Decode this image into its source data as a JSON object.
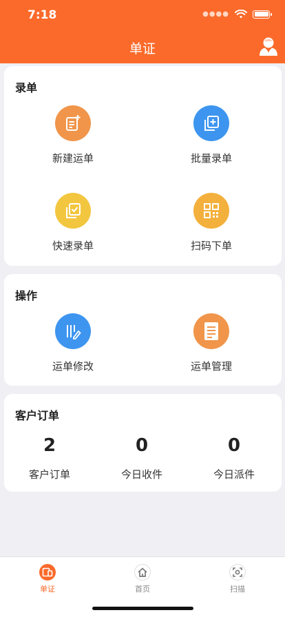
{
  "status": {
    "time": "7:18"
  },
  "nav": {
    "title": "单证",
    "user_icon": "user-avatar-icon"
  },
  "sections": {
    "entry": {
      "title": "录单",
      "items": [
        {
          "label": "新建运单",
          "icon": "new-waybill-icon",
          "color": "#f0954a"
        },
        {
          "label": "批量录单",
          "icon": "batch-entry-icon",
          "color": "#3d95f0"
        },
        {
          "label": "快速录单",
          "icon": "quick-entry-icon",
          "color": "#f3c640"
        },
        {
          "label": "扫码下单",
          "icon": "qr-code-icon",
          "color": "#f3b03c"
        }
      ]
    },
    "operation": {
      "title": "操作",
      "items": [
        {
          "label": "运单修改",
          "icon": "edit-waybill-icon",
          "color": "#3d95f0"
        },
        {
          "label": "运单管理",
          "icon": "manage-waybill-icon",
          "color": "#f0954a"
        }
      ]
    },
    "orders": {
      "title": "客户订单",
      "stats": [
        {
          "value": "2",
          "label": "客户订单"
        },
        {
          "value": "0",
          "label": "今日收件"
        },
        {
          "value": "0",
          "label": "今日派件"
        }
      ]
    }
  },
  "tabs": [
    {
      "label": "单证",
      "icon": "document-icon",
      "active": true
    },
    {
      "label": "首页",
      "icon": "home-icon",
      "active": false
    },
    {
      "label": "扫描",
      "icon": "scan-icon",
      "active": false
    }
  ],
  "colors": {
    "accent": "#fb6a2a",
    "background": "#efeff4"
  }
}
